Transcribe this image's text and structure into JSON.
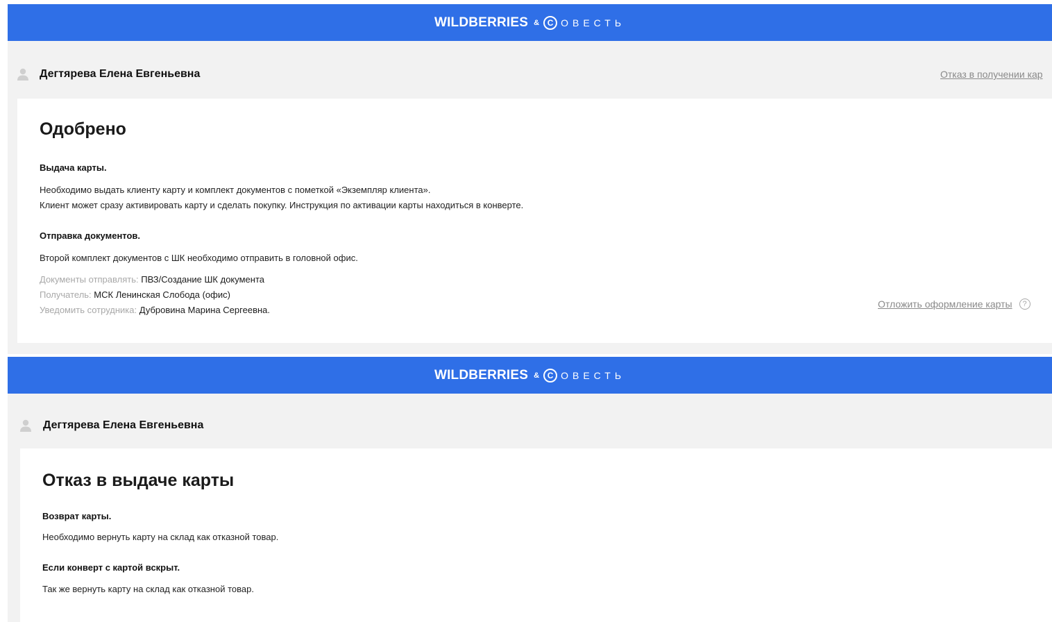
{
  "brand": {
    "wb": "WILDBERRIES",
    "amp": "&",
    "logo_letter": "С",
    "sovest": "ОВЕСТЬ",
    "color": "#2f6fe7"
  },
  "screen1": {
    "user_name": "Дегтярева Елена Евгеньевна",
    "user_icon": "user-icon",
    "refuse_link": "Отказ в получении кар",
    "title": "Одобрено",
    "sections": {
      "issue": {
        "title": "Выдача карты.",
        "line1": "Необходимо выдать клиенту карту и комплект документов с пометкой «Экземпляр клиента».",
        "line2": "Клиент может сразу активировать карту и сделать покупку. Инструкция по активации карты находиться в конверте."
      },
      "send": {
        "title": "Отправка документов.",
        "line1": "Второй комплект документов с ШК необходимо отправить в головной офис."
      }
    },
    "details": {
      "docs_label": "Документы отправлять:",
      "docs_value": "ПВЗ/Создание ШК документа",
      "recipient_label": "Получатель:",
      "recipient_value": "МСК Ленинская Слобода (офис)",
      "notify_label": "Уведомить сотрудника:",
      "notify_value": "Дубровина Марина Сергеевна."
    },
    "postpone_link": "Отложить оформление карты",
    "help_icon": "help-icon",
    "help_glyph": "?"
  },
  "screen2": {
    "user_name": "Дегтярева Елена Евгеньевна",
    "user_icon": "user-icon",
    "title": "Отказ в выдаче карты",
    "sections": {
      "return": {
        "title": "Возврат карты.",
        "line1": "Необходимо вернуть карту на склад как отказной товар."
      },
      "opened": {
        "title": "Если конверт с картой вскрыт.",
        "line1": "Так же вернуть карту на склад как отказной товар."
      }
    }
  }
}
